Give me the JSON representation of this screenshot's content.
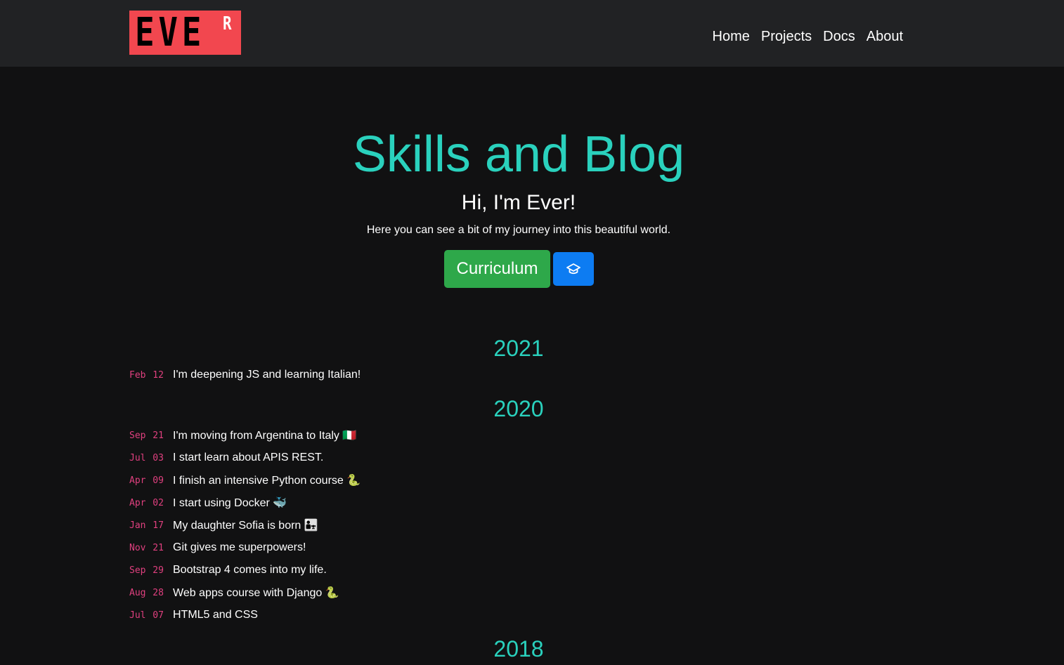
{
  "header": {
    "logo_text": "EVE",
    "logo_sup": "R",
    "nav": [
      "Home",
      "Projects",
      "Docs",
      "About"
    ]
  },
  "hero": {
    "title": "Skills and Blog",
    "subtitle": "Hi, I'm Ever!",
    "text": "Here you can see a bit of my journey into this beautiful world.",
    "curriculum_label": "Curriculum",
    "icon_button": "graduation-cap-icon"
  },
  "timeline": [
    {
      "year": "2021",
      "entries": [
        {
          "date": "Feb 12",
          "text": "I'm deepening JS and learning Italian!"
        }
      ]
    },
    {
      "year": "2020",
      "entries": [
        {
          "date": "Sep 21",
          "text": "I'm moving from Argentina to Italy 🇮🇹"
        },
        {
          "date": "Jul 03",
          "text": "I start learn about APIS REST."
        },
        {
          "date": "Apr 09",
          "text": "I finish an intensive Python course 🐍"
        },
        {
          "date": "Apr 02",
          "text": "I start using Docker 🐳"
        },
        {
          "date": "Jan 17",
          "text": "My daughter Sofia is born 👨‍👧"
        },
        {
          "date": "Nov 21",
          "text": "Git gives me superpowers!"
        },
        {
          "date": "Sep 29",
          "text": "Bootstrap 4 comes into my life."
        },
        {
          "date": "Aug 28",
          "text": "Web apps course with Django 🐍"
        },
        {
          "date": "Jul 07",
          "text": "HTML5 and CSS"
        }
      ]
    },
    {
      "year": "2018",
      "entries": []
    }
  ],
  "colors": {
    "accent": "#2ad1bd",
    "date": "#e0407f",
    "logo_bg": "#f2474f",
    "curriculum_btn": "#2ea84a",
    "icon_btn": "#0d7cf2"
  }
}
